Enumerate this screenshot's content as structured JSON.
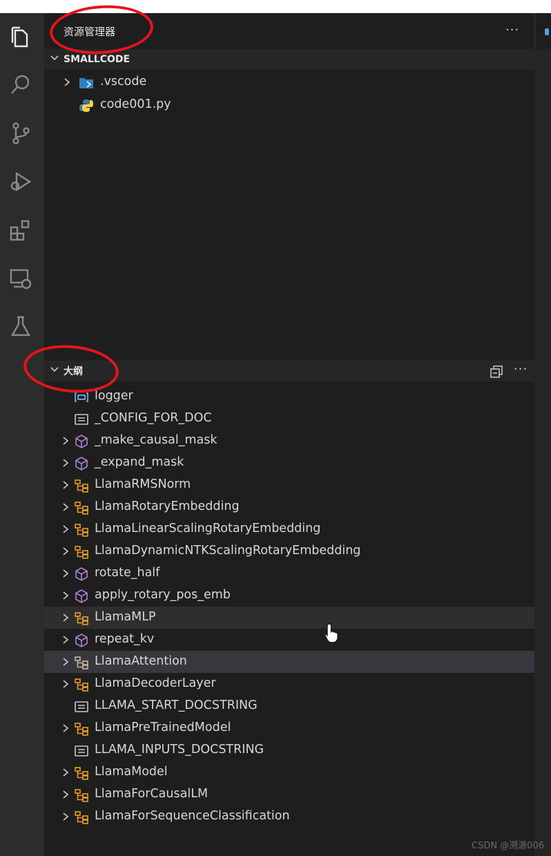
{
  "explorer": {
    "title": "资源管理器",
    "more": "···",
    "workspace": "SMALLCODE",
    "files": [
      {
        "label": ".vscode",
        "icon": "vscode-folder-icon",
        "expandable": true
      },
      {
        "label": "code001.py",
        "icon": "python-file-icon",
        "expandable": false
      }
    ]
  },
  "outline": {
    "title": "大纲",
    "more": "···",
    "items": [
      {
        "label": "logger",
        "kind": "variable",
        "expandable": false
      },
      {
        "label": "_CONFIG_FOR_DOC",
        "kind": "constant",
        "expandable": false
      },
      {
        "label": "_make_causal_mask",
        "kind": "function",
        "expandable": true
      },
      {
        "label": "_expand_mask",
        "kind": "function",
        "expandable": true
      },
      {
        "label": "LlamaRMSNorm",
        "kind": "class",
        "expandable": true
      },
      {
        "label": "LlamaRotaryEmbedding",
        "kind": "class",
        "expandable": true
      },
      {
        "label": "LlamaLinearScalingRotaryEmbedding",
        "kind": "class",
        "expandable": true
      },
      {
        "label": "LlamaDynamicNTKScalingRotaryEmbedding",
        "kind": "class",
        "expandable": true
      },
      {
        "label": "rotate_half",
        "kind": "function",
        "expandable": true
      },
      {
        "label": "apply_rotary_pos_emb",
        "kind": "function",
        "expandable": true
      },
      {
        "label": "LlamaMLP",
        "kind": "class",
        "expandable": true,
        "state": "hover"
      },
      {
        "label": "repeat_kv",
        "kind": "function",
        "expandable": true
      },
      {
        "label": "LlamaAttention",
        "kind": "class",
        "expandable": true,
        "state": "selected"
      },
      {
        "label": "LlamaDecoderLayer",
        "kind": "class",
        "expandable": true
      },
      {
        "label": "LLAMA_START_DOCSTRING",
        "kind": "constant",
        "expandable": false
      },
      {
        "label": "LlamaPreTrainedModel",
        "kind": "class",
        "expandable": true
      },
      {
        "label": "LLAMA_INPUTS_DOCSTRING",
        "kind": "constant",
        "expandable": false
      },
      {
        "label": "LlamaModel",
        "kind": "class",
        "expandable": true
      },
      {
        "label": "LlamaForCausalLM",
        "kind": "class",
        "expandable": true
      },
      {
        "label": "LlamaForSequenceClassification",
        "kind": "class",
        "expandable": true
      }
    ]
  },
  "activity_bar": [
    "explorer-icon",
    "search-icon",
    "source-control-icon",
    "run-debug-icon",
    "extensions-icon",
    "remote-explorer-icon",
    "testing-icon"
  ],
  "colors": {
    "class": "#ee9d28",
    "function": "#b180d7",
    "variable": "#75beff",
    "constant": "#cccccc",
    "accent_red": "#e8141b"
  },
  "watermark": "CSDN @溯源006"
}
